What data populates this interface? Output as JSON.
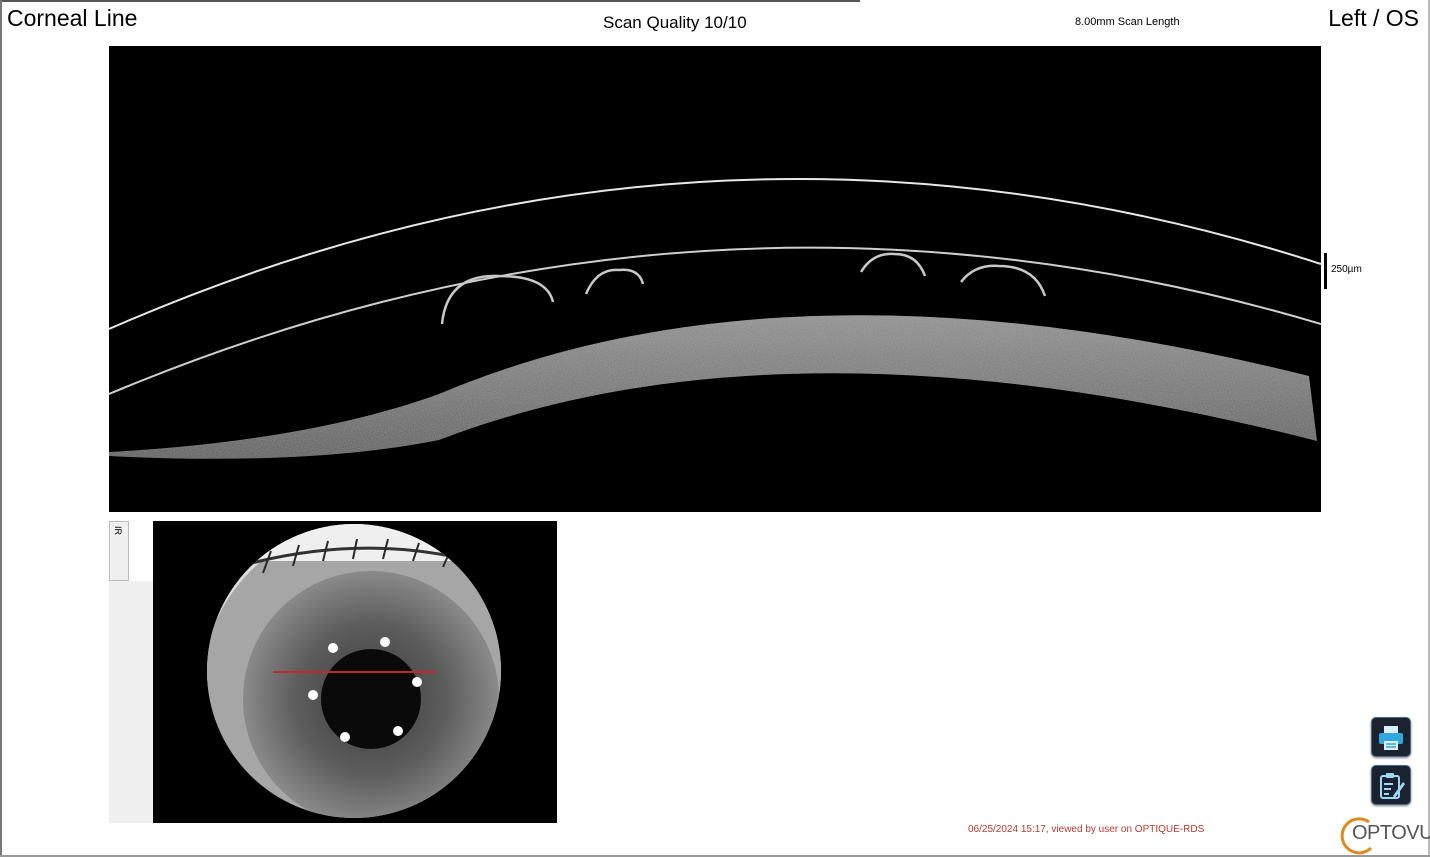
{
  "header": {
    "title": "Corneal Line",
    "scan_quality": "Scan Quality 10/10",
    "scan_length": "8.00mm Scan Length",
    "eye": "Left / OS"
  },
  "bscan": {
    "scale_label": "250µm"
  },
  "ir_panel": {
    "tab_label": "IR",
    "scan_line_color": "#c0282d"
  },
  "toolbar": {
    "print_icon": "printer-icon",
    "report_icon": "report-edit-icon"
  },
  "footer": {
    "status": "06/25/2024 15:17, viewed by user on OPTIQUE-RDS"
  },
  "brand": {
    "name": "OPTOVUE",
    "ring_color": "#e08a1e"
  }
}
